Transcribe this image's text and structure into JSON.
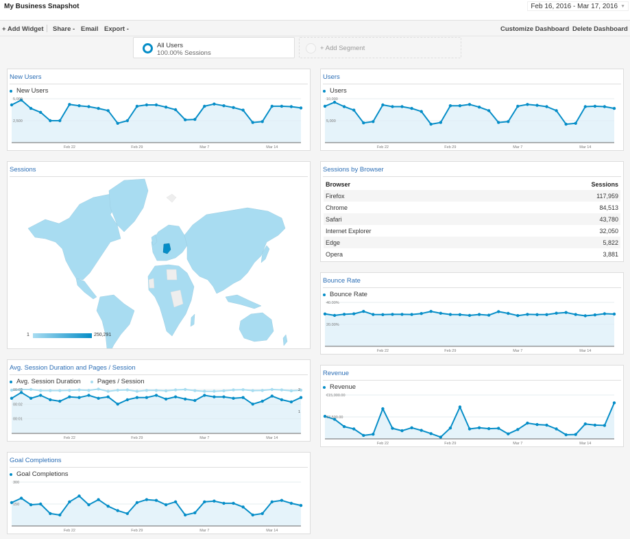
{
  "header": {
    "title": "My Business Snapshot",
    "date_range": "Feb 16, 2016 - Mar 17, 2016"
  },
  "toolbar": {
    "add_widget": "+ Add Widget",
    "share": "Share -",
    "email": "Email",
    "export": "Export -",
    "customize": "Customize Dashboard",
    "delete": "Delete Dashboard"
  },
  "segments": {
    "active": {
      "name": "All Users",
      "detail": "100.00% Sessions"
    },
    "add_label": "+ Add Segment"
  },
  "colors": {
    "primary": "#058dc7",
    "secondary": "#a6dcf0",
    "area": "#e5f3fa",
    "title": "#2a6db5"
  },
  "widgets": {
    "new_users": {
      "title": "New Users",
      "chart_data": {
        "type": "line",
        "title": "New Users",
        "x_ticks": [
          "Feb 22",
          "Feb 29",
          "Mar 7",
          "Mar 14"
        ],
        "y_ticks": [
          "5,000",
          "2,500"
        ],
        "ylim": [
          0,
          5000
        ],
        "series": [
          {
            "name": "New Users",
            "values": [
              4300,
              4850,
              3900,
              3450,
              2500,
              2500,
              4350,
              4200,
              4100,
              3900,
              3650,
              2200,
              2500,
              4150,
              4300,
              4300,
              4050,
              3750,
              2600,
              2650,
              4150,
              4400,
              4200,
              4000,
              3700,
              2300,
              2400,
              4150,
              4150,
              4100,
              3950
            ]
          }
        ]
      }
    },
    "users": {
      "title": "Users",
      "chart_data": {
        "type": "line",
        "title": "Users",
        "x_ticks": [
          "Feb 22",
          "Feb 29",
          "Mar 7",
          "Mar 14"
        ],
        "y_ticks": [
          "10,000",
          "5,000"
        ],
        "ylim": [
          0,
          10000
        ],
        "series": [
          {
            "name": "Users",
            "values": [
              8300,
              9200,
              8200,
              7400,
              4500,
              4800,
              8600,
              8200,
              8200,
              7800,
              7100,
              4200,
              4600,
              8400,
              8400,
              8700,
              8100,
              7300,
              4600,
              4800,
              8300,
              8700,
              8500,
              8200,
              7300,
              4200,
              4400,
              8200,
              8300,
              8200,
              7800
            ]
          }
        ]
      }
    },
    "sessions_map": {
      "title": "Sessions",
      "scale_min": "1",
      "scale_max": "250,291",
      "highlighted_country": "Germany"
    },
    "sessions_by_browser": {
      "title": "Sessions by Browser",
      "columns": [
        "Browser",
        "Sessions"
      ],
      "rows": [
        {
          "browser": "Firefox",
          "sessions": "117,959"
        },
        {
          "browser": "Chrome",
          "sessions": "84,513"
        },
        {
          "browser": "Safari",
          "sessions": "43,780"
        },
        {
          "browser": "Internet Explorer",
          "sessions": "32,050"
        },
        {
          "browser": "Edge",
          "sessions": "5,822"
        },
        {
          "browser": "Opera",
          "sessions": "3,881"
        }
      ]
    },
    "bounce_rate": {
      "title": "Bounce Rate",
      "chart_data": {
        "type": "line",
        "title": "Bounce Rate",
        "x_ticks": [
          "Feb 22",
          "Feb 29",
          "Mar 7",
          "Mar 14"
        ],
        "y_ticks": [
          "40.00%",
          "20.00%"
        ],
        "ylim": [
          0,
          40
        ],
        "series": [
          {
            "name": "Bounce Rate",
            "values": [
              29.5,
              28.2,
              29.2,
              29.6,
              31.8,
              29.0,
              28.9,
              29.1,
              29.1,
              29.0,
              29.9,
              31.8,
              30.1,
              29.0,
              28.9,
              28.2,
              29.0,
              28.4,
              31.6,
              30.0,
              28.0,
              29.1,
              28.9,
              28.9,
              30.2,
              30.8,
              29.0,
              27.8,
              28.6,
              29.7,
              29.4
            ]
          }
        ]
      }
    },
    "avg_session": {
      "title": "Avg. Session Duration and Pages / Session",
      "chart_data": {
        "type": "line",
        "title": "Avg. Session Duration and Pages / Session",
        "x_ticks": [
          "Feb 22",
          "Feb 29",
          "Mar 7",
          "Mar 14"
        ],
        "y_ticks_left": [
          "00:03",
          "00:02",
          "00:01"
        ],
        "y_ticks_right": [
          "2",
          "1"
        ],
        "ylim_left_seconds": [
          0,
          3
        ],
        "ylim_right": [
          0,
          2
        ],
        "series": [
          {
            "name": "Avg. Session Duration",
            "axis": "left",
            "values": [
              2.4,
              2.8,
              2.4,
              2.6,
              2.3,
              2.2,
              2.5,
              2.45,
              2.6,
              2.4,
              2.5,
              2.0,
              2.3,
              2.45,
              2.45,
              2.6,
              2.35,
              2.5,
              2.35,
              2.25,
              2.6,
              2.5,
              2.5,
              2.4,
              2.45,
              2.0,
              2.2,
              2.55,
              2.3,
              2.15,
              2.45
            ]
          },
          {
            "name": "Pages / Session",
            "axis": "right",
            "values": [
              1.97,
              2.0,
              2.0,
              1.95,
              1.95,
              1.95,
              1.96,
              1.98,
              1.96,
              2.02,
              1.92,
              1.97,
              1.98,
              1.92,
              1.96,
              1.96,
              1.94,
              1.98,
              2.0,
              1.95,
              1.92,
              1.92,
              1.94,
              1.98,
              1.99,
              1.95,
              1.96,
              2.0,
              1.98,
              1.94,
              1.97
            ]
          }
        ]
      }
    },
    "revenue": {
      "title": "Revenue",
      "chart_data": {
        "type": "line",
        "title": "Revenue",
        "x_ticks": [
          "Feb 22",
          "Feb 29",
          "Mar 7",
          "Mar 14"
        ],
        "y_ticks": [
          "€15,000.00",
          "€7,500.00"
        ],
        "ylim": [
          0,
          15000
        ],
        "series": [
          {
            "name": "Revenue",
            "values": [
              7700,
              6700,
              4200,
              3400,
              1200,
              1600,
              10300,
              3600,
              2800,
              3800,
              2900,
              1800,
              600,
              3700,
              10900,
              3400,
              3800,
              3500,
              3600,
              1700,
              3200,
              5400,
              4900,
              4700,
              3400,
              1400,
              1500,
              5100,
              4700,
              4600,
              12300
            ]
          }
        ]
      }
    },
    "goal_completions": {
      "title": "Goal Completions",
      "chart_data": {
        "type": "line",
        "title": "Goal Completions",
        "x_ticks": [
          "Feb 22",
          "Feb 29",
          "Mar 7",
          "Mar 14"
        ],
        "y_ticks": [
          "300",
          "150"
        ],
        "ylim": [
          0,
          300
        ],
        "series": [
          {
            "name": "Goal Completions",
            "values": [
              160,
              190,
              145,
              150,
              85,
              75,
              165,
              205,
              145,
              180,
              135,
              105,
              85,
              160,
              180,
              175,
              145,
              165,
              75,
              90,
              165,
              170,
              155,
              155,
              130,
              75,
              85,
              165,
              175,
              155,
              140
            ]
          }
        ]
      }
    }
  }
}
